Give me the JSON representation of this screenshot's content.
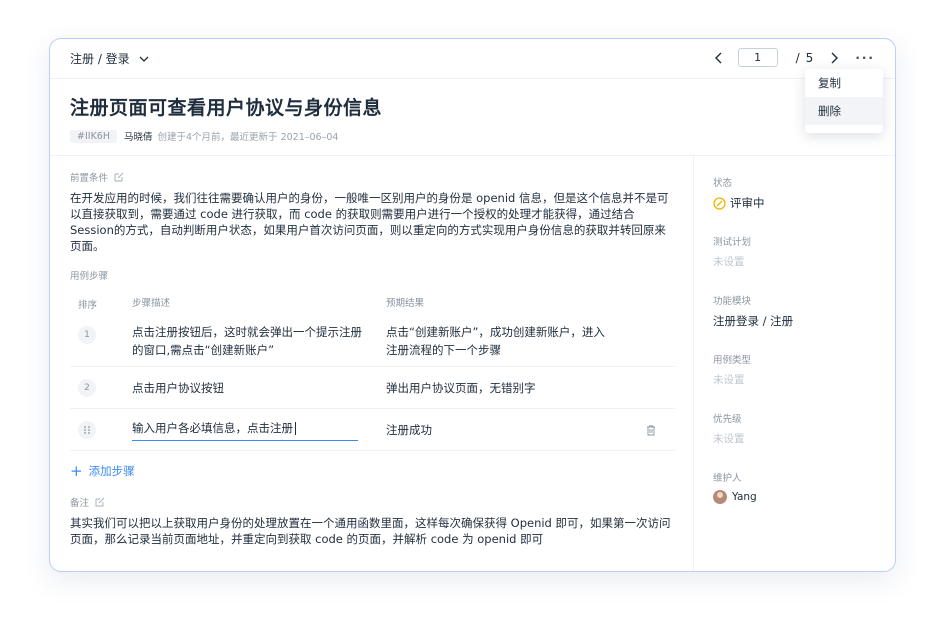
{
  "breadcrumb": {
    "text": "注册 / 登录"
  },
  "pager": {
    "current": "1",
    "separator": "/",
    "total": "5"
  },
  "menu": {
    "items": [
      "复制",
      "删除"
    ]
  },
  "case": {
    "title": "注册页面可查看用户协议与身份信息",
    "id": "#IIK6H",
    "author": "马晓倩",
    "meta": "创建于4个月前，最近更新于 2021–06–04"
  },
  "precondition": {
    "label": "前置条件",
    "text": "在开发应用的时候，我们往往需要确认用户的身份，一般唯一区别用户的身份是 openid 信息，但是这个信息并不是可以直接获取到，需要通过 code 进行获取，而 code 的获取则需要用户进行一个授权的处理才能获得，通过结合Session的方式，自动判断用户状态，如果用户首次访问页面，则以重定向的方式实现用户身份信息的获取并转回原来页面。"
  },
  "steps": {
    "label": "用例步骤",
    "headers": {
      "order": "排序",
      "desc": "步骤描述",
      "expected": "预期结果"
    },
    "rows": [
      {
        "num": "1",
        "desc": "点击注册按钮后，这时就会弹出一个提示注册的窗口,需点击“创建新账户”",
        "expected": "点击“创建新账户”，成功创建新账户，进入注册流程的下一个步骤"
      },
      {
        "num": "2",
        "desc": "点击用户协议按钮",
        "expected": "弹出用户协议页面，无错别字"
      }
    ],
    "editing_row": {
      "desc": "输入用户各必填信息，点击注册",
      "expected": "注册成功"
    },
    "add_label": "添加步骤"
  },
  "notes": {
    "label": "备注",
    "text": "其实我们可以把以上获取用户身份的处理放置在一个通用函数里面，这样每次确保获得 Openid 即可，如果第一次访问页面，那么记录当前页面地址，并重定向到获取 code 的页面，并解析 code 为 openid 即可"
  },
  "sidebar": {
    "status": {
      "label": "状态",
      "value": "评审中",
      "color": "#f5b400"
    },
    "plan": {
      "label": "测试计划",
      "value": "未设置"
    },
    "module": {
      "label": "功能模块",
      "value": "注册登录 / 注册"
    },
    "type": {
      "label": "用例类型",
      "value": "未设置"
    },
    "priority": {
      "label": "优先级",
      "value": "未设置"
    },
    "maintainer": {
      "label": "维护人",
      "value": "Yang"
    }
  },
  "colors": {
    "accent": "#3d8cf0",
    "border": "#b7d1f5"
  }
}
